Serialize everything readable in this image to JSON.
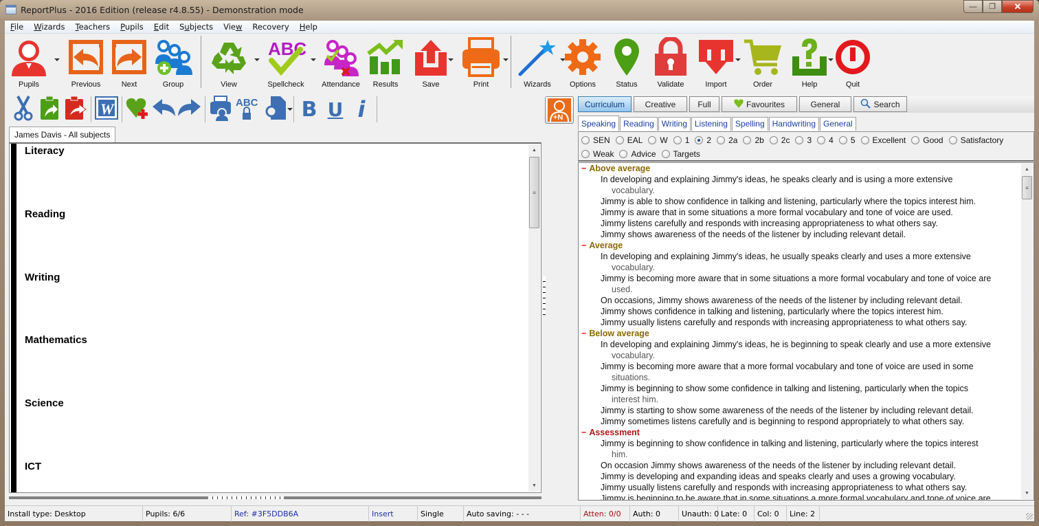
{
  "window": {
    "title": "ReportPlus - 2016 Edition (release r4.8.55) - Demonstration mode",
    "controls": {
      "minimize": "—",
      "maximize": "❐",
      "close": "✕"
    }
  },
  "menubar": {
    "items": [
      {
        "pre": "",
        "u": "F",
        "post": "ile"
      },
      {
        "pre": "",
        "u": "W",
        "post": "izards"
      },
      {
        "pre": "",
        "u": "T",
        "post": "eachers"
      },
      {
        "pre": "",
        "u": "P",
        "post": "upils"
      },
      {
        "pre": "",
        "u": "E",
        "post": "dit"
      },
      {
        "pre": "S",
        "u": "u",
        "post": "bjects"
      },
      {
        "pre": "Vie",
        "u": "w",
        "post": ""
      },
      {
        "pre": "Recovery",
        "u": "",
        "post": ""
      },
      {
        "pre": "",
        "u": "H",
        "post": "elp"
      }
    ]
  },
  "toolbar": {
    "pupils": "Pupils",
    "previous": "Previous",
    "next": "Next",
    "group": "Group",
    "view": "View",
    "spellcheck": "Spellcheck",
    "attendance": "Attendance",
    "results": "Results",
    "save": "Save",
    "print": "Print",
    "wizards": "Wizards",
    "options": "Options",
    "status": "Status",
    "validate": "Validate",
    "import": "Import",
    "order": "Order",
    "help": "Help",
    "quit": "Quit"
  },
  "format_toolbar": {
    "bold": "B",
    "underline": "U",
    "italic": "i",
    "spell_abc": "ABC",
    "word": "W"
  },
  "document": {
    "tab_label": "James Davis - All subjects",
    "subjects": [
      "Literacy",
      "Reading",
      "Writing",
      "Mathematics",
      "Science",
      "ICT"
    ]
  },
  "comment_bank": {
    "add_note_label": "+N",
    "tabs": [
      {
        "label": "Curriculum",
        "active": true
      },
      {
        "label": "Creative",
        "active": false
      },
      {
        "label": "Full",
        "active": false
      },
      {
        "label": "Favourites",
        "active": false
      },
      {
        "label": "General",
        "active": false
      },
      {
        "label": "Search",
        "active": false
      }
    ],
    "sub_tabs": [
      {
        "label": "Speaking",
        "active": true
      },
      {
        "label": "Reading",
        "active": false
      },
      {
        "label": "Writing",
        "active": false
      },
      {
        "label": "Listening",
        "active": false
      },
      {
        "label": "Spelling",
        "active": false
      },
      {
        "label": "Handwriting",
        "active": false
      },
      {
        "label": "General",
        "active": false
      }
    ],
    "levels": [
      {
        "label": "SEN",
        "checked": false
      },
      {
        "label": "EAL",
        "checked": false
      },
      {
        "label": "W",
        "checked": false
      },
      {
        "label": "1",
        "checked": false
      },
      {
        "label": "2",
        "checked": true
      },
      {
        "label": "2a",
        "checked": false
      },
      {
        "label": "2b",
        "checked": false
      },
      {
        "label": "2c",
        "checked": false
      },
      {
        "label": "3",
        "checked": false
      },
      {
        "label": "4",
        "checked": false
      },
      {
        "label": "5",
        "checked": false
      },
      {
        "label": "Excellent",
        "checked": false
      },
      {
        "label": "Good",
        "checked": false
      },
      {
        "label": "Satisfactory",
        "checked": false
      },
      {
        "label": "Weak",
        "checked": false
      },
      {
        "label": "Advice",
        "checked": false
      },
      {
        "label": "Targets",
        "checked": false
      }
    ],
    "groups": [
      {
        "title": "Above average",
        "color": "#8a6a00",
        "comments": [
          {
            "text": "In developing and explaining Jimmy's ideas, he speaks clearly and is using a more extensive",
            "cont": "vocabulary."
          },
          {
            "text": "Jimmy is able to show confidence in talking and listening, particularly where the topics interest him.",
            "cont": ""
          },
          {
            "text": "Jimmy is aware that in some situations a more formal vocabulary and tone of voice are used.",
            "cont": ""
          },
          {
            "text": "Jimmy listens carefully and responds with increasing appropriateness to what others say.",
            "cont": ""
          },
          {
            "text": "Jimmy shows awareness of the needs of the listener by including relevant detail.",
            "cont": ""
          }
        ]
      },
      {
        "title": "Average",
        "color": "#8a6a00",
        "comments": [
          {
            "text": "In developing and explaining Jimmy's ideas, he usually speaks clearly and uses a more extensive",
            "cont": "vocabulary."
          },
          {
            "text": "Jimmy is becoming more aware that in some situations a more formal vocabulary and tone of voice are",
            "cont": "used."
          },
          {
            "text": "On occasions, Jimmy shows awareness of the needs of the listener by including relevant detail.",
            "cont": ""
          },
          {
            "text": "Jimmy shows confidence in talking and listening, particularly where the topics interest him.",
            "cont": ""
          },
          {
            "text": "Jimmy usually listens carefully and responds with increasing appropriateness to what others say.",
            "cont": ""
          }
        ]
      },
      {
        "title": "Below average",
        "color": "#8a6a00",
        "comments": [
          {
            "text": "In developing and explaining Jimmy's ideas, he is beginning to speak clearly and use a more extensive",
            "cont": "vocabulary."
          },
          {
            "text": "Jimmy is becoming more aware that a more formal vocabulary and tone of voice are used in some",
            "cont": "situations."
          },
          {
            "text": "Jimmy is beginning to show some confidence in talking and listening, particularly when the topics",
            "cont": "interest him."
          },
          {
            "text": "Jimmy is starting to show some awareness of the needs of the listener by including relevant detail.",
            "cont": ""
          },
          {
            "text": "Jimmy sometimes listens carefully and is beginning to respond appropriately to what others say.",
            "cont": ""
          }
        ]
      },
      {
        "title": "Assessment",
        "color": "#b01818",
        "comments": [
          {
            "text": "Jimmy is beginning to show confidence in talking and listening, particularly where the topics interest",
            "cont": "him."
          },
          {
            "text": "On occasion Jimmy shows awareness of the needs of the listener by including relevant detail.",
            "cont": ""
          },
          {
            "text": "Jimmy is developing and expanding ideas and speaks clearly and uses a growing vocabulary.",
            "cont": ""
          },
          {
            "text": "Jimmy usually listens carefully and responds with increasing appropriateness to what others say.",
            "cont": ""
          },
          {
            "text": "Jimmy is beginning to be aware that in some situations a more formal vocabulary and tone of voice are",
            "cont": ""
          }
        ]
      }
    ]
  },
  "statusbar": {
    "install_type": "Install type: Desktop",
    "pupils": "Pupils: 6/6",
    "ref": "Ref: #3F5DDB6A",
    "mode": "Insert",
    "selection": "Single",
    "auto_saving": "Auto saving: - - -",
    "attendance": "Atten: 0/0",
    "auth": "Auth: 0",
    "unauth": "Unauth: 0",
    "late": "Late: 0",
    "col": "Col: 0",
    "line": "Line: 2"
  },
  "colors": {
    "ref_text": "#1a2fa0",
    "insert_text": "#1a2fa0",
    "atten_text": "#a01010",
    "active_tab": "#92c6ef",
    "subtab_text": "#1a3fa0"
  }
}
